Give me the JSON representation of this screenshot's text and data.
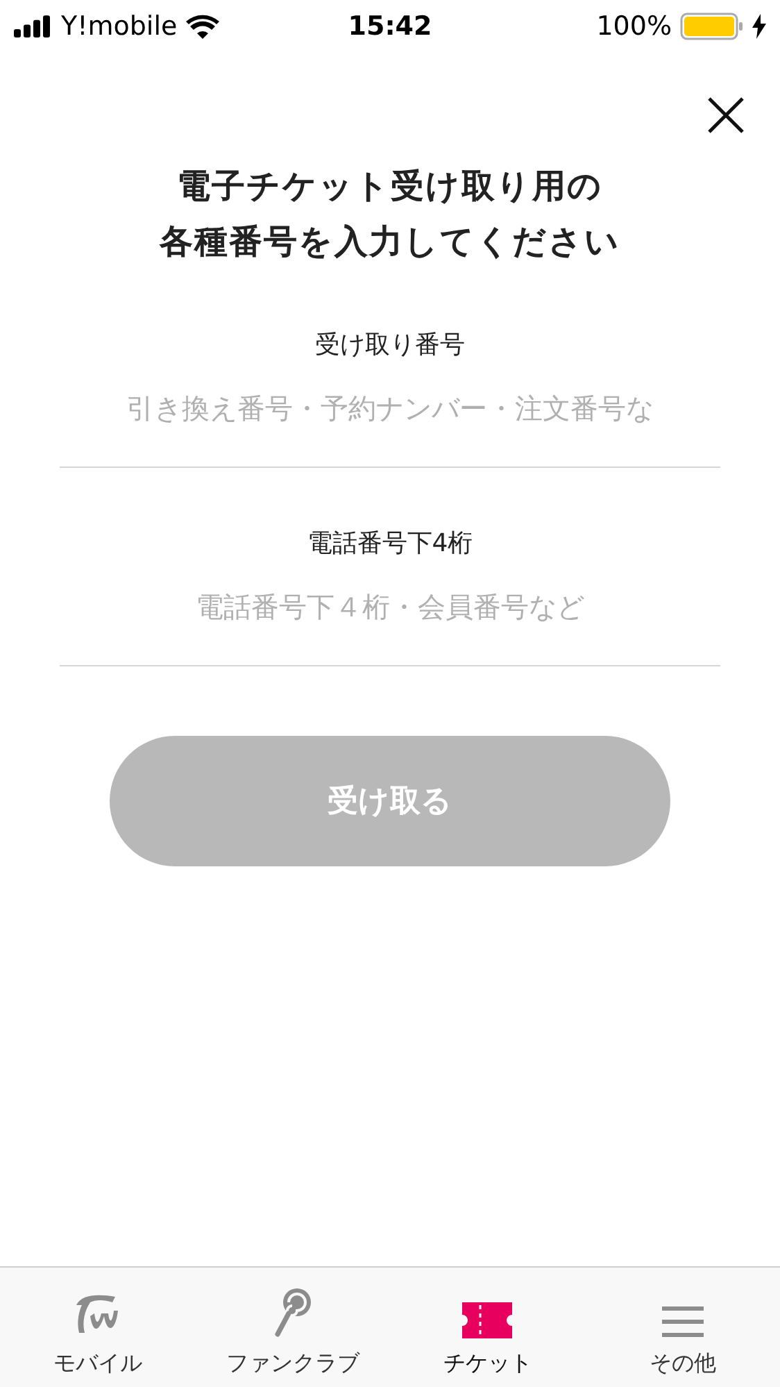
{
  "status_bar": {
    "carrier": "Y!mobile",
    "time": "15:42",
    "battery": "100%"
  },
  "title_lines": [
    "電子チケット受け取り用の",
    "各種番号を入力してください"
  ],
  "fields": [
    {
      "label": "受け取り番号",
      "placeholder": "引き換え番号・予約ナンバー・注文番号な"
    },
    {
      "label": "電話番号下4桁",
      "placeholder": "電話番号下４桁・会員番号など"
    }
  ],
  "submit": {
    "label": "受け取る",
    "disabled": true
  },
  "tab_bar": [
    {
      "label": "モバイル",
      "kind": "script",
      "selected": false
    },
    {
      "label": "ファンクラブ",
      "kind": "lollipop",
      "selected": false
    },
    {
      "label": "チケット",
      "kind": "ticket",
      "selected": true
    },
    {
      "label": "その他",
      "kind": "menu",
      "selected": false
    }
  ]
}
